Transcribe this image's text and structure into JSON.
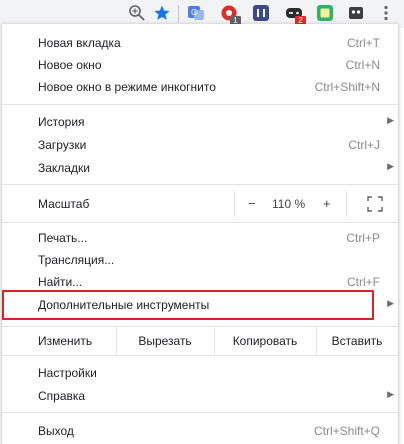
{
  "menu": {
    "new_tab": {
      "label": "Новая вкладка",
      "shortcut": "Ctrl+T"
    },
    "new_window": {
      "label": "Новое окно",
      "shortcut": "Ctrl+N"
    },
    "incognito": {
      "label": "Новое окно в режиме инкогнито",
      "shortcut": "Ctrl+Shift+N"
    },
    "history": {
      "label": "История"
    },
    "downloads": {
      "label": "Загрузки",
      "shortcut": "Ctrl+J"
    },
    "bookmarks": {
      "label": "Закладки"
    },
    "zoom": {
      "label": "Масштаб",
      "minus": "−",
      "value": "110 %",
      "plus": "+"
    },
    "print": {
      "label": "Печать...",
      "shortcut": "Ctrl+P"
    },
    "cast": {
      "label": "Трансляция..."
    },
    "find": {
      "label": "Найти...",
      "shortcut": "Ctrl+F"
    },
    "more_tools": {
      "label": "Дополнительные инструменты"
    },
    "edit": {
      "label": "Изменить",
      "cut": "Вырезать",
      "copy": "Копировать",
      "paste": "Вставить"
    },
    "settings": {
      "label": "Настройки"
    },
    "help": {
      "label": "Справка"
    },
    "exit": {
      "label": "Выход",
      "shortcut": "Ctrl+Shift+Q"
    }
  },
  "toolbar": {
    "badge_1": "1",
    "badge_2": "2"
  },
  "colors": {
    "highlight_border": "#d02828",
    "star": "#1a73e8"
  }
}
